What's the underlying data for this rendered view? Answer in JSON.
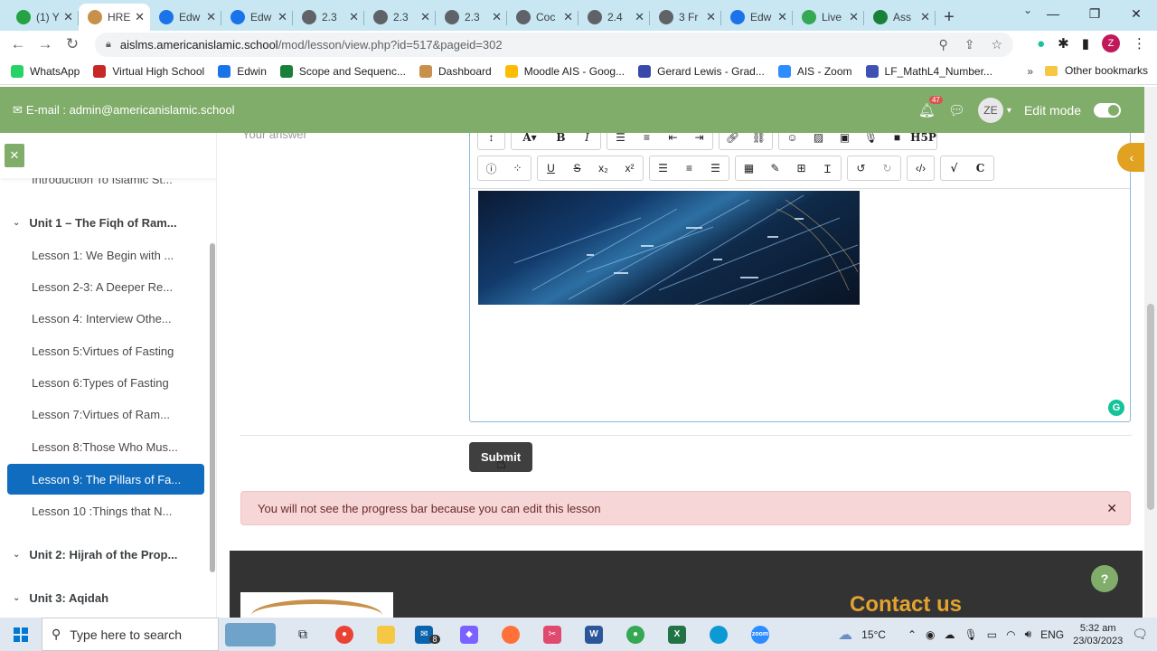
{
  "browser": {
    "tabs": [
      {
        "label": "(1) Y",
        "color": "#25a244"
      },
      {
        "label": "HRE",
        "color": "#c8914b",
        "active": true
      },
      {
        "label": "Edw",
        "color": "#1a73e8"
      },
      {
        "label": "Edw",
        "color": "#1a73e8"
      },
      {
        "label": "2.3",
        "color": "#5f6368"
      },
      {
        "label": "2.3",
        "color": "#5f6368"
      },
      {
        "label": "2.3",
        "color": "#5f6368"
      },
      {
        "label": "Coc",
        "color": "#5f6368"
      },
      {
        "label": "2.4",
        "color": "#5f6368"
      },
      {
        "label": "3 Fr",
        "color": "#5f6368"
      },
      {
        "label": "Edw",
        "color": "#1a73e8"
      },
      {
        "label": "Live",
        "color": "#34a853"
      },
      {
        "label": "Ass",
        "color": "#188038"
      }
    ],
    "url_host": "aislms.americanislamic.school",
    "url_path": "/mod/lesson/view.php?id=517&pageid=302",
    "profile_initial": "Z",
    "bookmarks": [
      {
        "label": "WhatsApp",
        "color": "#25d366"
      },
      {
        "label": "Virtual High School",
        "color": "#c62828"
      },
      {
        "label": "Edwin",
        "color": "#1a73e8"
      },
      {
        "label": "Scope and Sequenc...",
        "color": "#188038"
      },
      {
        "label": "Dashboard",
        "color": "#c8914b"
      },
      {
        "label": "Moodle AIS - Goog...",
        "color": "#fbbc04"
      },
      {
        "label": "Gerard Lewis - Grad...",
        "color": "#3949ab"
      },
      {
        "label": "AIS - Zoom",
        "color": "#2d8cff"
      },
      {
        "label": "LF_MathL4_Number...",
        "color": "#3f51b5"
      }
    ],
    "other_bookmarks": "Other bookmarks"
  },
  "header": {
    "email": "E-mail : admin@americanislamic.school",
    "notification_count": "47",
    "user_initials": "ZE",
    "edit_mode_label": "Edit mode",
    "edit_mode_on": true
  },
  "sidebar": {
    "partial_item": "Introduction To Islamic St...",
    "sections": [
      {
        "label": "Unit 1 – The Fiqh of Ram..."
      },
      {
        "label": "Unit 2: Hijrah of the Prop..."
      },
      {
        "label": "Unit 3: Aqidah"
      }
    ],
    "lessons": [
      "Lesson 1: We Begin with ...",
      "Lesson 2-3: A Deeper Re...",
      "Lesson 4: Interview Othe...",
      "Lesson 5:Virtues of Fasting",
      "Lesson 6:Types of Fasting",
      "Lesson 7:Virtues of Ram...",
      "Lesson 8:Those Who Mus...",
      "Lesson 9: The Pillars of Fa...",
      "Lesson 10 :Things that N..."
    ],
    "active_lesson_index": 7
  },
  "main": {
    "answer_label": "Your answer",
    "submit_label": "Submit",
    "alert_text": "You will not see the progress bar because you can edit this lesson",
    "footer_contact": "Contact us"
  },
  "taskbar": {
    "search_placeholder": "Type here to search",
    "mail_badge": "8",
    "temperature": "15°C",
    "language": "ENG",
    "time": "5:32 am",
    "date": "23/03/2023"
  }
}
